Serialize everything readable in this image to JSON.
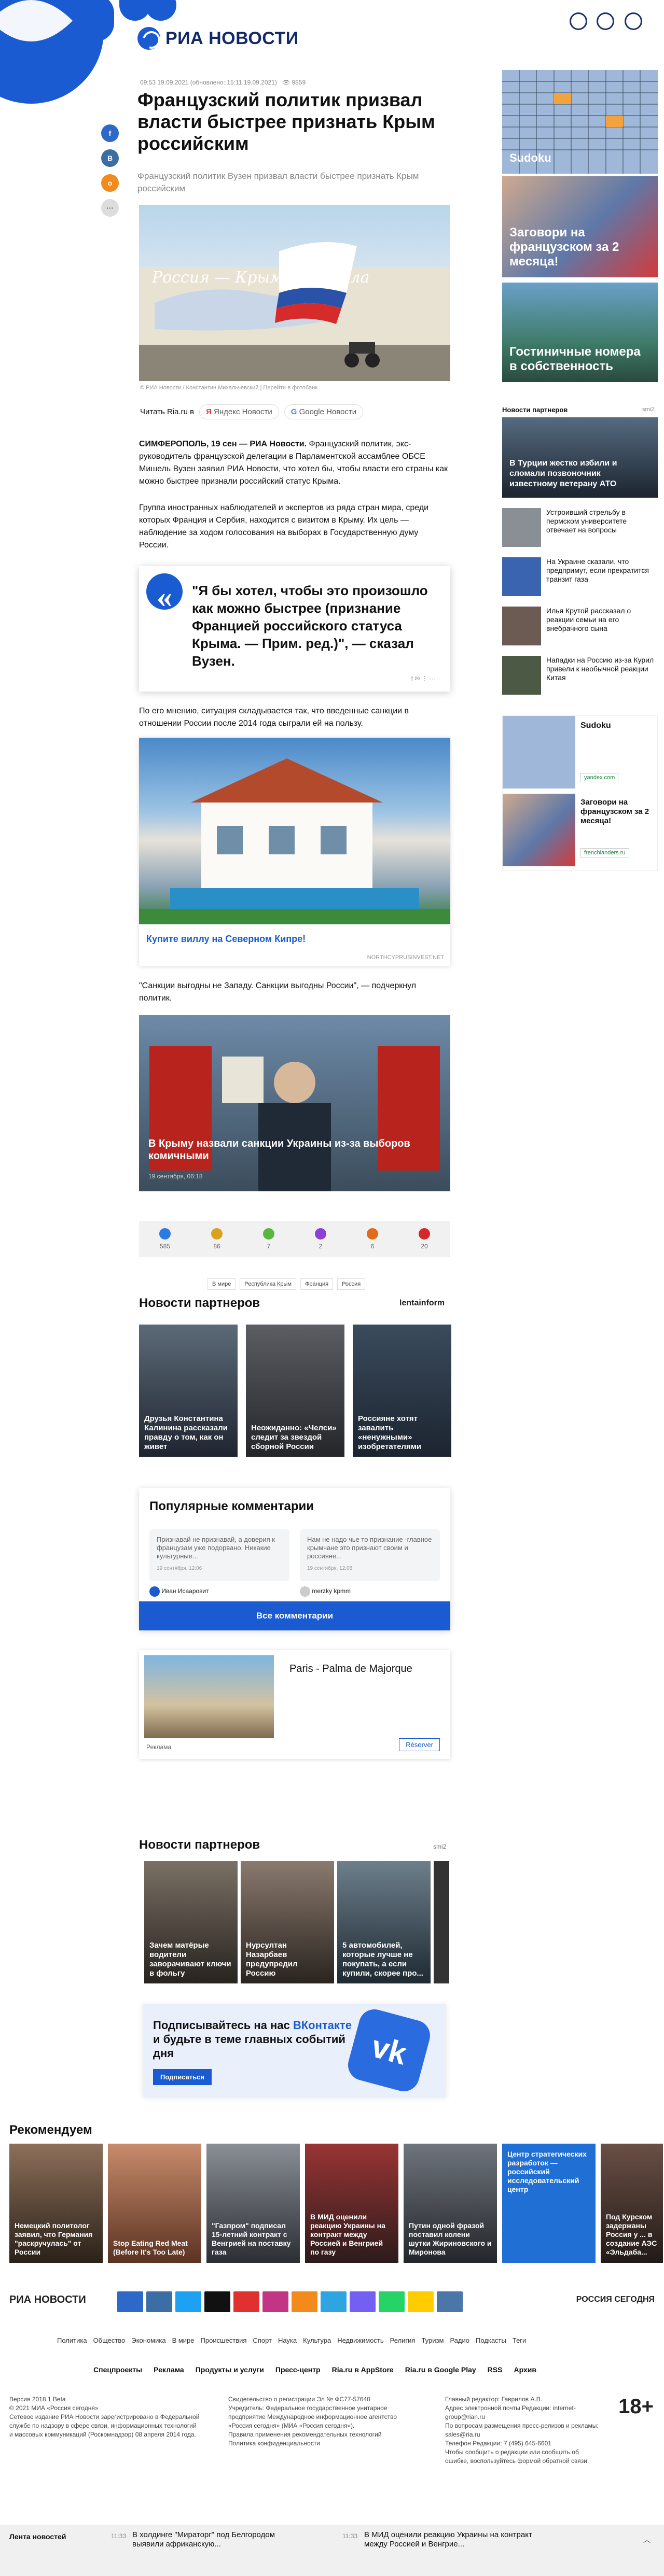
{
  "header": {
    "logo": "РИА НОВОСТИ"
  },
  "article": {
    "meta": "09:53 19.09.2021 (обновлено: 15:11 19.09.2021)",
    "views": "9859",
    "title": "Французский политик призвал власти быстрее признать Крым российским",
    "subtitle": "Французский политик Вузен призвал власти быстрее признать Крым российским",
    "image_overlay": "Россия — Крымская Мала",
    "image_caption": "© РИА Новости / Константин Михальчевский | Перейти в фотобанк",
    "read_in": "Читать Ria.ru в",
    "yandex": "Яндекс Новости",
    "google": "Google Новости",
    "p1_lead": "СИМФЕРОПОЛЬ, 19 сен — РИА Новости.",
    "p1": " Французский политик, экс-руководитель французской делегации в Парламентской ассамблее ОБСЕ Мишель Вузен заявил РИА Новости, что хотел бы, чтобы власти его страны как можно быстрее признали российский статус Крыма.",
    "p2": "Группа иностранных наблюдателей и экспертов из ряда стран мира, среди которых Франция и Сербия, находится с визитом в Крыму. Их цель — наблюдение за ходом голосования на выборах в Государственную думу России.",
    "quote": "\"Я бы хотел, чтобы это произошло как можно быстрее (признание Францией российского статуса Крыма. — Прим. ред.)\", — сказал Вузен.",
    "p3": "По его мнению, ситуация складывается так, что введенные санкции в отношении России после 2014 года сыграли ей на пользу.",
    "ad1_title": "Купите виллу на Северном Кипре!",
    "ad1_source": "NORTHCYPRUSINVEST.NET",
    "p4": "\"Санкции выгодны не Западу. Санкции выгодны России\", — подчеркнул политик.",
    "card2_title": "В Крыму назвали санкции Украины из-за выборов комичными",
    "card2_meta": "19 сентября, 06:18"
  },
  "reactions": [
    {
      "count": "585",
      "color": "#2d7be0"
    },
    {
      "count": "86",
      "color": "#d8a21d"
    },
    {
      "count": "7",
      "color": "#5bb641"
    },
    {
      "count": "2",
      "color": "#8d3fd4"
    },
    {
      "count": "6",
      "color": "#e36a1a"
    },
    {
      "count": "20",
      "color": "#d2292a"
    }
  ],
  "tags": [
    "В мире",
    "Республика Крым",
    "Франция",
    "Россия"
  ],
  "partners1": {
    "title": "Новости партнеров",
    "brand": "lentainform",
    "items": [
      "Друзья Константина Калинина рассказали правду о том, как он живет",
      "Неожиданно: «Челси» следит за звездой сборной России",
      "Россияне хотят завалить «ненужными» изобретателями"
    ]
  },
  "comments": {
    "title": "Популярные комментарии",
    "c1": "Признавай не признавай, а доверия к французам уже подорвано. Никакие культурные...",
    "c1date": "19 сентября, 12:06",
    "c1user": "Иван Исааровит",
    "c2": "Нам не надо чье то признание -главное крымчане это признают своим и россияне...",
    "c2date": "19 сентября, 12:08",
    "c2user": "merzky kpmm",
    "button": "Все комментарии"
  },
  "ad2": {
    "title": "Paris - Palma de Majorque",
    "label": "Реклама",
    "button": "Réserver"
  },
  "partners2": {
    "title": "Новости партнеров",
    "brand": "smi2",
    "items": [
      "Зачем матёрые водители заворачивают ключи в фольгу",
      "Нурсултан Назарбаев предупредил Россию",
      "5 автомобилей, которые лучше не покупать, а если купили, скорее про..."
    ]
  },
  "vk": {
    "text1": "Подписывайтесь на нас ",
    "text2": "ВКонтакте",
    "text3": " и будьте в теме главных событий дня",
    "button": "Подписаться"
  },
  "recommended": {
    "title": "Рекомендуем",
    "items": [
      "Немецкий политолог заявил, что Германия \"раскручулась\" от России",
      "Stop Eating Red Meat (Before It's Too Late)",
      "\"Газпром\" подписал 15-летний контракт с Венгрией на поставку газа",
      "В МИД оценили реакцию Украины на контракт между Россией и Венгрией по газу",
      "Путин одной фразой поставил колени шутки Жириновского и Миронова",
      "Центр стратегических разработок — российский исследовательский центр",
      "Под Курском задержаны Россия у ... в создание АЭС «Эльдаба..."
    ]
  },
  "sidebar": {
    "sudoku": "Sudoku",
    "card1": "Заговори на французском за 2 месяца!",
    "card2": "Гостиничные номера в собственность",
    "partners_title": "Новости партнеров",
    "partners_brand": "smi2",
    "featured": "В Турции жестко избили и сломали позвоночник известному ветерану АТО",
    "news": [
      "Устроивший стрельбу в пермском университете отвечает на вопросы",
      "На Украине сказали, что предпримут, если прекратится транзит газа",
      "Илья Крутой рассказал о реакции семьи на его внебрачного сына",
      "Нападки на Россию из-за Курил привели к необычной реакции Китая"
    ],
    "sudoku2": "Sudoku",
    "sudoku2_src": "yandex.com",
    "french2": "Заговори на французском за 2 месяца!",
    "french2_src": "frenchlanders.ru"
  },
  "footer": {
    "logo": "РИА НОВОСТИ",
    "rs": "РОССИЯ СЕГОДНЯ",
    "nav": [
      "Политика",
      "Общество",
      "Экономика",
      "В мире",
      "Происшествия",
      "Спорт",
      "Наука",
      "Культура",
      "Недвижимость",
      "Религия",
      "Туризм",
      "Радио",
      "Подкасты",
      "Теги"
    ],
    "nav2": [
      "Спецпроекты",
      "Реклама",
      "Продукты и услуги",
      "Пресс-центр",
      "Ria.ru в AppStore",
      "Ria.ru в Google Play",
      "RSS",
      "Архив"
    ],
    "col1": "Версия 2018.1 Beta\n© 2021 МИА «Россия сегодня»\nСетевое издание РИА Новости зарегистрировано в Федеральной службе по надзору в сфере связи, информационных технологий и массовых коммуникаций (Роскомнадзор) 08 апреля 2014 года.",
    "col2": "Свидетельство о регистрации Эл № ФС77-57640\nУчредитель: Федеральное государственное унитарное предприятие Международное информационное агентство «Россия сегодня» (МИА «Россия сегодня»).\nПравила применения рекомендательных технологий\nПолитика конфиденциальности",
    "col3": "Главный редактор: Гаврилов А.В.\nАдрес электронной почты Редакции: internet-group@rian.ru\nПо вопросам размещения пресс-релизов и рекламы: sales@ria.ru\nТелефон Редакции: 7 (495) 645-6601\nЧтобы сообщить о редакции или сообщить об ошибке, воспользуйтесь формой обратной связи.",
    "age": "18+"
  },
  "bottom": {
    "label": "Лента новостей",
    "time1": "11:33",
    "item1": "В холдинге \"Мираторг\" под Белгородом выявили африканскую...",
    "time2": "11:33",
    "item2": "В МИД оценили реакцию Украины на контракт между Россией и Венгрие..."
  }
}
